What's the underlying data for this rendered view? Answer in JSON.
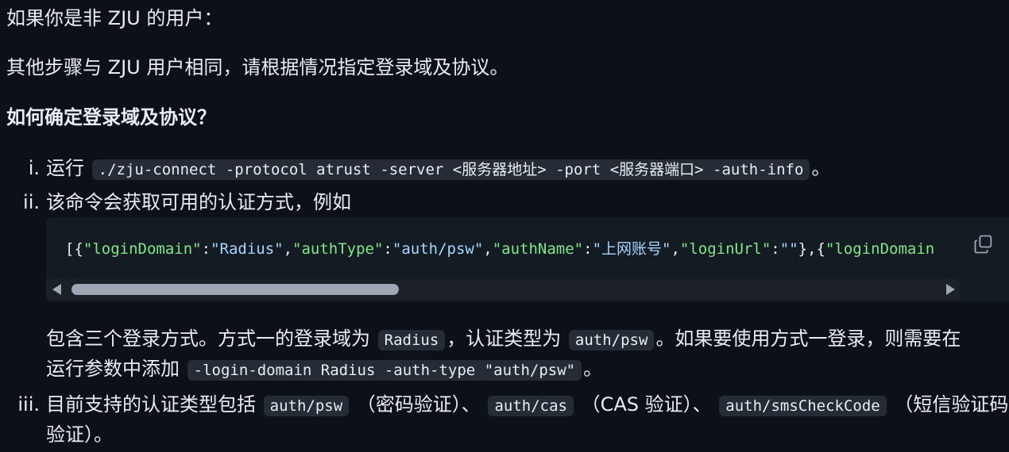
{
  "para1": "如果你是非 ZJU 的用户：",
  "para2": "其他步骤与 ZJU 用户相同，请根据情况指定登录域及协议。",
  "heading": "如何确定登录域及协议？",
  "items": [
    {
      "marker": "i.",
      "text_before": "运行",
      "code": "./zju-connect -protocol atrust -server <服务器地址> -port <服务器端口> -auth-info",
      "text_after": "。"
    },
    {
      "marker": "ii.",
      "text": "该命令会获取可用的认证方式，例如"
    },
    {
      "marker": "iii.",
      "text_a": "目前支持的认证类型包括",
      "code_a": "auth/psw",
      "text_b": "（密码验证）、",
      "code_b": "auth/cas",
      "text_c": "（CAS 验证）、",
      "code_c": "auth/smsCheckCode",
      "text_d": "（短信验证码",
      "text_e": "验证）。"
    }
  ],
  "codeblock": {
    "tokens": [
      {
        "t": "[{",
        "c": "plain"
      },
      {
        "t": "\"loginDomain\"",
        "c": "key"
      },
      {
        "t": ":",
        "c": "plain"
      },
      {
        "t": "\"Radius\"",
        "c": "str"
      },
      {
        "t": ",",
        "c": "plain"
      },
      {
        "t": "\"authType\"",
        "c": "key"
      },
      {
        "t": ":",
        "c": "plain"
      },
      {
        "t": "\"auth/psw\"",
        "c": "str"
      },
      {
        "t": ",",
        "c": "plain"
      },
      {
        "t": "\"authName\"",
        "c": "key"
      },
      {
        "t": ":",
        "c": "plain"
      },
      {
        "t": "\"上网账号\"",
        "c": "str"
      },
      {
        "t": ",",
        "c": "plain"
      },
      {
        "t": "\"loginUrl\"",
        "c": "key"
      },
      {
        "t": ":",
        "c": "plain"
      },
      {
        "t": "\"\"",
        "c": "str"
      },
      {
        "t": "},{",
        "c": "plain"
      },
      {
        "t": "\"loginDomain",
        "c": "key"
      }
    ],
    "copy_icon": "copy-icon",
    "scroll_fraction": 0.36
  },
  "explain": {
    "text_a": "包含三个登录方式。方式一的登录域为",
    "code_a": "Radius",
    "text_b": "，认证类型为",
    "code_b": "auth/psw",
    "text_c": "。如果要使用方式一登录，则需要在",
    "text_d": "运行参数中添加",
    "code_d": "-login-domain Radius -auth-type \"auth/psw\"",
    "text_e": "。"
  },
  "colors": {
    "background": "#0d1117",
    "text": "#e6edf3",
    "json_key": "#7ee787",
    "json_string": "#a5d6ff"
  }
}
